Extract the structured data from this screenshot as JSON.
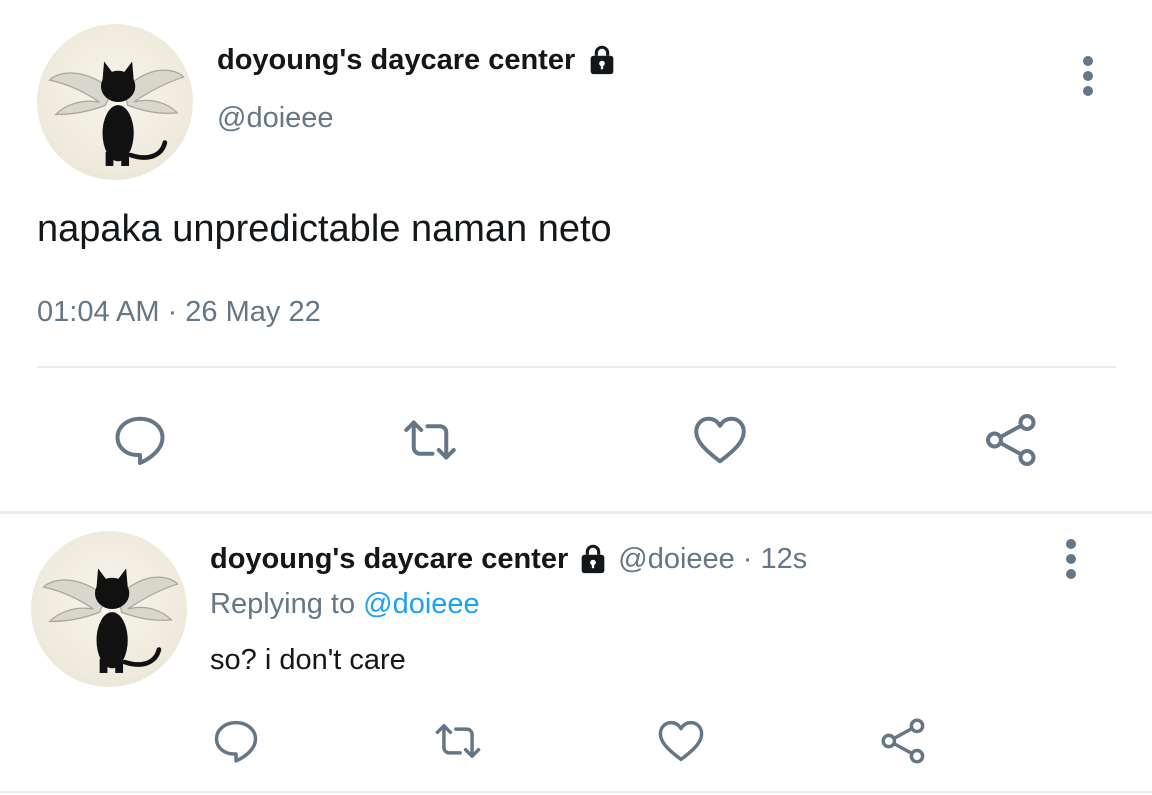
{
  "main_tweet": {
    "display_name": "doyoung's daycare center",
    "handle": "@doieee",
    "text": "napaka unpredictable naman neto",
    "timestamp": "01:04 AM · 26 May 22",
    "locked": true
  },
  "reply_tweet": {
    "display_name": "doyoung's daycare center",
    "handle": "@doieee",
    "separator": "·",
    "age": "12s",
    "replying_prefix": "Replying to",
    "replying_to": "@doieee",
    "text": "so? i don't care",
    "locked": true
  },
  "icons": {
    "lock": "lock-icon",
    "more": "more-vertical-icon",
    "reply": "reply-bubble-icon",
    "retweet": "retweet-icon",
    "like": "heart-icon",
    "share": "share-icon"
  },
  "colors": {
    "text_primary": "#14171a",
    "text_secondary": "#657786",
    "link": "#1da1f2",
    "divider": "#e6ecf0",
    "icon": "#657786"
  }
}
